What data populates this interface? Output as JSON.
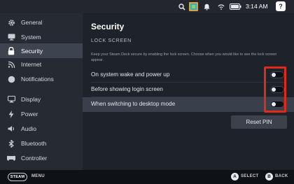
{
  "status": {
    "time": "3:14 AM"
  },
  "sidebar": {
    "items": [
      {
        "label": "General",
        "icon": "gear-icon"
      },
      {
        "label": "System",
        "icon": "monitor-icon"
      },
      {
        "label": "Security",
        "icon": "lock-icon",
        "active": true
      },
      {
        "label": "Internet",
        "icon": "wifi-icon"
      },
      {
        "label": "Notifications",
        "icon": "circle-icon"
      },
      {
        "label": "Display",
        "icon": "display-icon"
      },
      {
        "label": "Power",
        "icon": "lightning-icon"
      },
      {
        "label": "Audio",
        "icon": "speaker-icon"
      },
      {
        "label": "Bluetooth",
        "icon": "bluetooth-icon"
      },
      {
        "label": "Controller",
        "icon": "gamepad-icon"
      }
    ]
  },
  "main": {
    "title": "Security",
    "section": "LOCK SCREEN",
    "description": "Keep your Steam Deck secure by enabling the lock screen. Choose when you would like to see the lock screen appear.",
    "settings": [
      {
        "label": "On system wake and power up",
        "enabled": false
      },
      {
        "label": "Before showing login screen",
        "enabled": false
      },
      {
        "label": "When switching to desktop mode",
        "enabled": false
      }
    ],
    "reset_button": "Reset PIN"
  },
  "footer": {
    "steam_label": "STEAM",
    "menu_label": "MENU",
    "a_glyph": "A",
    "select_label": "SELECT",
    "b_glyph": "B",
    "back_label": "BACK"
  },
  "colors": {
    "highlight_box": "#e02a1a",
    "active_item_bg": "#3d4450",
    "main_bg": "#1e232b"
  }
}
